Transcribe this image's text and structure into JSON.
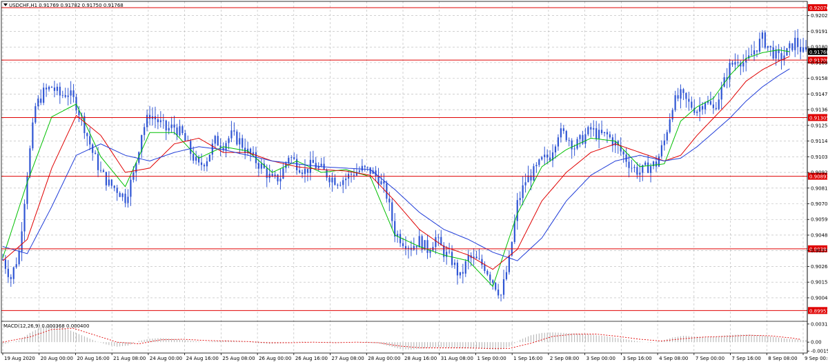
{
  "header": {
    "symbol_line": "USDCHF,H1  0.91769 0.91782 0.91750 0.91768"
  },
  "colors": {
    "background": "#ffffff",
    "grid": "#b4b4b4",
    "candles": "#2f55d4",
    "ma_fast": "#00c000",
    "ma_mid": "#e00000",
    "ma_slow": "#1f3cd8",
    "level_line": "#e00000",
    "level_label_bg": "#e00000",
    "current_price_bg": "#000000",
    "macd_hist": "#b0b0b0",
    "macd_signal": "#e00000"
  },
  "chart_data": [
    {
      "type": "line",
      "subtype": "candlestick",
      "title": "USDCHF,H1",
      "ohlc_last": {
        "open": 0.91769,
        "high": 0.91782,
        "low": 0.9175,
        "close": 0.91768
      },
      "ylim": [
        0.8988,
        0.9212
      ],
      "y_ticks": [
        "0.92020",
        "0.91910",
        "0.91800",
        "0.91690",
        "0.91580",
        "0.91470",
        "0.91360",
        "0.91250",
        "0.91140",
        "0.91030",
        "0.90920",
        "0.90810",
        "0.90700",
        "0.90590",
        "0.90480",
        "0.90370",
        "0.90260",
        "0.90150",
        "0.90040"
      ],
      "x_ticks": [
        "19 Aug 2020",
        "20 Aug 00:00",
        "20 Aug 16:00",
        "21 Aug 08:00",
        "24 Aug 00:00",
        "24 Aug 16:00",
        "25 Aug 08:00",
        "26 Aug 00:00",
        "26 Aug 16:00",
        "27 Aug 08:00",
        "28 Aug 00:00",
        "28 Aug 16:00",
        "31 Aug 08:00",
        "1 Sep 00:00",
        "1 Sep 16:00",
        "2 Sep 08:00",
        "3 Sep 00:00",
        "3 Sep 16:00",
        "4 Sep 08:00",
        "7 Sep 00:00",
        "7 Sep 16:00",
        "8 Sep 08:00",
        "9 Sep 00:00"
      ],
      "current_price": "0.91768",
      "levels": [
        "0.92076",
        "0.91708",
        "0.91305",
        "0.90893",
        "0.90384",
        "0.89951"
      ],
      "close_path": [
        [
          0,
          0.9031
        ],
        [
          3,
          0.9018
        ],
        [
          6,
          0.9036
        ],
        [
          9,
          0.9092
        ],
        [
          12,
          0.9138
        ],
        [
          15,
          0.9148
        ],
        [
          18,
          0.9152
        ],
        [
          21,
          0.9146
        ],
        [
          24,
          0.9148
        ],
        [
          27,
          0.914
        ],
        [
          30,
          0.9124
        ],
        [
          33,
          0.9106
        ],
        [
          36,
          0.9092
        ],
        [
          39,
          0.9084
        ],
        [
          42,
          0.908
        ],
        [
          45,
          0.9074
        ],
        [
          48,
          0.909
        ],
        [
          51,
          0.912
        ],
        [
          54,
          0.9133
        ],
        [
          57,
          0.9128
        ],
        [
          60,
          0.9122
        ],
        [
          63,
          0.9124
        ],
        [
          66,
          0.9118
        ],
        [
          69,
          0.9106
        ],
        [
          72,
          0.9096
        ],
        [
          75,
          0.9102
        ],
        [
          78,
          0.9114
        ],
        [
          81,
          0.9112
        ],
        [
          84,
          0.9118
        ],
        [
          87,
          0.9114
        ],
        [
          90,
          0.9106
        ],
        [
          93,
          0.91
        ],
        [
          96,
          0.9094
        ],
        [
          99,
          0.9086
        ],
        [
          102,
          0.9089
        ],
        [
          105,
          0.9104
        ],
        [
          108,
          0.9098
        ],
        [
          111,
          0.9093
        ],
        [
          114,
          0.9098
        ],
        [
          117,
          0.9094
        ],
        [
          120,
          0.9089
        ],
        [
          123,
          0.9086
        ],
        [
          126,
          0.9088
        ],
        [
          129,
          0.9092
        ],
        [
          132,
          0.9094
        ],
        [
          135,
          0.9093
        ],
        [
          138,
          0.9088
        ],
        [
          141,
          0.9076
        ],
        [
          144,
          0.905
        ],
        [
          147,
          0.9044
        ],
        [
          150,
          0.904
        ],
        [
          153,
          0.9044
        ],
        [
          156,
          0.9038
        ],
        [
          159,
          0.9046
        ],
        [
          162,
          0.9036
        ],
        [
          165,
          0.903
        ],
        [
          168,
          0.9018
        ],
        [
          171,
          0.9032
        ],
        [
          174,
          0.903
        ],
        [
          177,
          0.9026
        ],
        [
          180,
          0.9016
        ],
        [
          183,
          0.9006
        ],
        [
          186,
          0.903
        ],
        [
          189,
          0.907
        ],
        [
          192,
          0.9086
        ],
        [
          195,
          0.9092
        ],
        [
          198,
          0.91
        ],
        [
          201,
          0.9104
        ],
        [
          204,
          0.912
        ],
        [
          207,
          0.9118
        ],
        [
          210,
          0.911
        ],
        [
          213,
          0.9116
        ],
        [
          216,
          0.9122
        ],
        [
          219,
          0.9118
        ],
        [
          222,
          0.9118
        ],
        [
          225,
          0.9112
        ],
        [
          228,
          0.9104
        ],
        [
          231,
          0.9096
        ],
        [
          234,
          0.9092
        ],
        [
          237,
          0.9096
        ],
        [
          240,
          0.9098
        ],
        [
          243,
          0.9114
        ],
        [
          246,
          0.914
        ],
        [
          249,
          0.9146
        ],
        [
          252,
          0.914
        ],
        [
          255,
          0.9136
        ],
        [
          258,
          0.9143
        ],
        [
          261,
          0.9136
        ],
        [
          264,
          0.915
        ],
        [
          267,
          0.9166
        ],
        [
          270,
          0.9172
        ],
        [
          273,
          0.9168
        ],
        [
          276,
          0.9178
        ],
        [
          279,
          0.9186
        ],
        [
          282,
          0.9178
        ],
        [
          285,
          0.9172
        ],
        [
          288,
          0.9176
        ],
        [
          291,
          0.9184
        ],
        [
          294,
          0.9176
        ]
      ],
      "series": [
        {
          "name": "",
          "values": [
            0.9032,
            0.9085,
            0.9131,
            0.914,
            0.9103,
            0.9082,
            0.912,
            0.912,
            0.9102,
            0.911,
            0.9107,
            0.9092,
            0.91,
            0.9092,
            0.9094,
            0.9089,
            0.9048,
            0.904,
            0.9034,
            0.903,
            0.9012,
            0.9063,
            0.9096,
            0.9108,
            0.9116,
            0.9114,
            0.9096,
            0.9098,
            0.9128,
            0.9138,
            0.9144,
            0.916,
            0.9172,
            0.9176,
            0.9178,
            0.9176
          ],
          "x": [
            0,
            9,
            18,
            27,
            36,
            45,
            54,
            63,
            72,
            81,
            90,
            99,
            108,
            117,
            126,
            135,
            144,
            153,
            162,
            171,
            180,
            189,
            198,
            207,
            216,
            225,
            234,
            243,
            249,
            255,
            261,
            267,
            273,
            279,
            285,
            291
          ]
        },
        {
          "name": "",
          "values": [
            0.903,
            0.9045,
            0.9095,
            0.9132,
            0.9118,
            0.9092,
            0.9095,
            0.9112,
            0.9116,
            0.9106,
            0.9106,
            0.91,
            0.9096,
            0.9094,
            0.9093,
            0.909,
            0.9072,
            0.9052,
            0.904,
            0.9034,
            0.9024,
            0.9038,
            0.9072,
            0.9092,
            0.9106,
            0.9112,
            0.9106,
            0.91,
            0.9104,
            0.9118,
            0.913,
            0.9142,
            0.9156,
            0.9164,
            0.917,
            0.9175
          ],
          "x": [
            0,
            9,
            18,
            27,
            36,
            45,
            54,
            63,
            72,
            81,
            90,
            99,
            108,
            117,
            126,
            135,
            144,
            153,
            162,
            171,
            180,
            189,
            198,
            207,
            216,
            225,
            234,
            243,
            249,
            255,
            261,
            267,
            273,
            279,
            285,
            291
          ]
        },
        {
          "name": "",
          "values": [
            0.904,
            0.9035,
            0.9068,
            0.9104,
            0.9112,
            0.9104,
            0.91,
            0.9106,
            0.911,
            0.9108,
            0.9104,
            0.91,
            0.9098,
            0.9096,
            0.9095,
            0.9094,
            0.908,
            0.9064,
            0.9052,
            0.9045,
            0.9036,
            0.903,
            0.9046,
            0.9072,
            0.909,
            0.91,
            0.9104,
            0.91,
            0.9102,
            0.911,
            0.912,
            0.913,
            0.9142,
            0.9152,
            0.916,
            0.9167
          ],
          "x": [
            0,
            9,
            18,
            27,
            36,
            45,
            54,
            63,
            72,
            81,
            90,
            99,
            108,
            117,
            126,
            135,
            144,
            153,
            162,
            171,
            180,
            189,
            198,
            207,
            216,
            225,
            234,
            243,
            249,
            255,
            261,
            267,
            273,
            279,
            285,
            291
          ]
        }
      ]
    },
    {
      "type": "bar",
      "title": "MACD(12,26,9) 0.000368 0.000400",
      "ylim": [
        -0.0019,
        0.0035
      ],
      "y_ticks": [
        "0.003154",
        "0.00",
        "-0.00156"
      ],
      "histogram_path": [
        [
          0,
          -0.0004
        ],
        [
          6,
          0.0003
        ],
        [
          10,
          0.0016
        ],
        [
          14,
          0.0026
        ],
        [
          18,
          0.003
        ],
        [
          22,
          0.0026
        ],
        [
          26,
          0.0018
        ],
        [
          30,
          0.001
        ],
        [
          34,
          0.0002
        ],
        [
          38,
          -0.0004
        ],
        [
          42,
          -0.0008
        ],
        [
          46,
          -0.0006
        ],
        [
          50,
          0.0002
        ],
        [
          54,
          0.0006
        ],
        [
          58,
          0.0007
        ],
        [
          62,
          0.0006
        ],
        [
          66,
          0.0004
        ],
        [
          70,
          0.0002
        ],
        [
          74,
          0.0
        ],
        [
          78,
          0.0002
        ],
        [
          82,
          0.0003
        ],
        [
          86,
          0.0002
        ],
        [
          90,
          0.0
        ],
        [
          94,
          -0.0002
        ],
        [
          98,
          -0.0003
        ],
        [
          102,
          -0.0002
        ],
        [
          106,
          0.0
        ],
        [
          110,
          0.0001
        ],
        [
          114,
          0.0
        ],
        [
          118,
          -0.0001
        ],
        [
          122,
          -0.0001
        ],
        [
          126,
          0.0
        ],
        [
          130,
          0.0
        ],
        [
          134,
          -0.0001
        ],
        [
          138,
          -0.0002
        ],
        [
          142,
          -0.0007
        ],
        [
          146,
          -0.0012
        ],
        [
          150,
          -0.0013
        ],
        [
          154,
          -0.0011
        ],
        [
          158,
          -0.0009
        ],
        [
          162,
          -0.0009
        ],
        [
          166,
          -0.001
        ],
        [
          170,
          -0.0011
        ],
        [
          174,
          -0.0011
        ],
        [
          178,
          -0.0012
        ],
        [
          182,
          -0.0014
        ],
        [
          186,
          -0.0008
        ],
        [
          190,
          0.0004
        ],
        [
          194,
          0.0012
        ],
        [
          198,
          0.0016
        ],
        [
          202,
          0.0017
        ],
        [
          206,
          0.0016
        ],
        [
          210,
          0.0015
        ],
        [
          214,
          0.0014
        ],
        [
          218,
          0.0012
        ],
        [
          222,
          0.001
        ],
        [
          226,
          0.0007
        ],
        [
          230,
          0.0004
        ],
        [
          234,
          0.0001
        ],
        [
          238,
          -0.0001
        ],
        [
          242,
          0.0002
        ],
        [
          246,
          0.0008
        ],
        [
          250,
          0.0011
        ],
        [
          254,
          0.001
        ],
        [
          258,
          0.0009
        ],
        [
          262,
          0.001
        ],
        [
          266,
          0.0012
        ],
        [
          270,
          0.0013
        ],
        [
          274,
          0.0013
        ],
        [
          278,
          0.0012
        ],
        [
          282,
          0.001
        ],
        [
          286,
          0.0007
        ],
        [
          290,
          0.0005
        ],
        [
          294,
          0.0004
        ]
      ],
      "signal_path": [
        [
          0,
          0.0
        ],
        [
          10,
          0.0009
        ],
        [
          18,
          0.0022
        ],
        [
          26,
          0.0024
        ],
        [
          34,
          0.0012
        ],
        [
          42,
          0.0
        ],
        [
          50,
          -0.0003
        ],
        [
          58,
          0.0004
        ],
        [
          66,
          0.0005
        ],
        [
          74,
          0.0003
        ],
        [
          82,
          0.0002
        ],
        [
          90,
          0.0001
        ],
        [
          98,
          -0.0001
        ],
        [
          106,
          -0.0001
        ],
        [
          114,
          0.0
        ],
        [
          122,
          -0.0001
        ],
        [
          130,
          0.0
        ],
        [
          138,
          -0.0001
        ],
        [
          146,
          -0.0007
        ],
        [
          154,
          -0.001
        ],
        [
          162,
          -0.001
        ],
        [
          170,
          -0.001
        ],
        [
          178,
          -0.0011
        ],
        [
          186,
          -0.0011
        ],
        [
          194,
          -0.0002
        ],
        [
          202,
          0.001
        ],
        [
          210,
          0.0014
        ],
        [
          218,
          0.0014
        ],
        [
          226,
          0.001
        ],
        [
          234,
          0.0005
        ],
        [
          242,
          0.0002
        ],
        [
          250,
          0.0006
        ],
        [
          258,
          0.0009
        ],
        [
          266,
          0.001
        ],
        [
          274,
          0.0012
        ],
        [
          282,
          0.0011
        ],
        [
          290,
          0.0007
        ],
        [
          294,
          0.0004
        ]
      ]
    }
  ]
}
